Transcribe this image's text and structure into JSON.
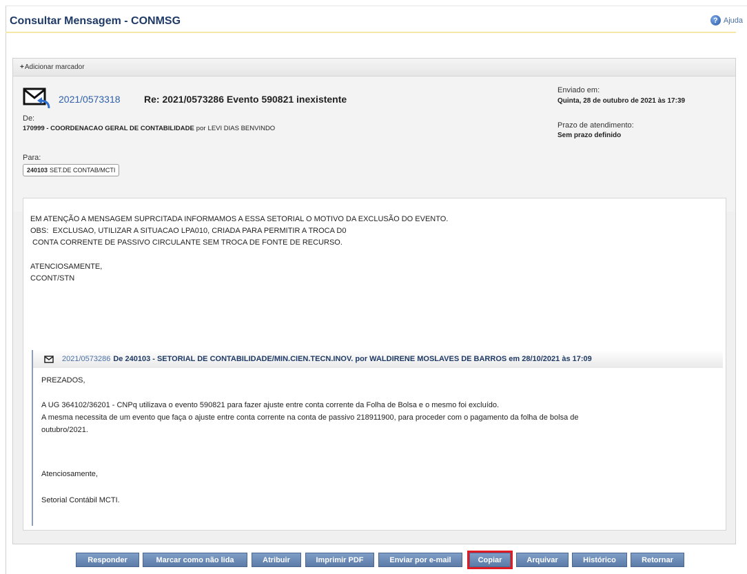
{
  "header": {
    "title": "Consultar Mensagem - CONMSG",
    "help_label": "Ajuda",
    "help_glyph": "?"
  },
  "marker": {
    "plus": "+",
    "label": "Adicionar marcador"
  },
  "message": {
    "id": "2021/0573318",
    "subject": "Re: 2021/0573286 Evento 590821 inexistente",
    "from_label": "De:",
    "from_org": "170999 - COORDENACAO GERAL DE CONTABILIDADE",
    "from_por": "por",
    "from_user": "LEVI DIAS BENVINDO",
    "sent_label": "Enviado em:",
    "sent_date": "Quinta, 28 de outubro de 2021 às 17:39",
    "deadline_label": "Prazo de atendimento:",
    "deadline_value": "Sem prazo definido",
    "to_label": "Para:",
    "to_code": "240103",
    "to_name": "SET.DE CONTAB/MCTI",
    "body": [
      "EM ATENÇÃO A MENSAGEM SUPRCITADA INFORMAMOS A ESSA SETORIAL O MOTIVO DA EXCLUSÃO DO EVENTO.",
      "OBS:  EXCLUSAO, UTILIZAR A SITUACAO LPA010, CRIADA PARA PERMITIR A TROCA D0",
      " CONTA CORRENTE DE PASSIVO CIRCULANTE SEM TROCA DE FONTE DE RECURSO.",
      "ATENCIOSAMENTE,",
      "CCONT/STN"
    ]
  },
  "quoted": {
    "id": "2021/0573286",
    "title": "De 240103 - SETORIAL DE CONTABILIDADE/MIN.CIEN.TECN.INOV. por WALDIRENE MOSLAVES DE BARROS em 28/10/2021 às 17:09",
    "body": [
      "PREZADOS,",
      "A UG 364102/36201 - CNPq utilizava o evento 590821 para fazer ajuste entre conta corrente da Folha de Bolsa e o mesmo foi excluído.",
      "A mesma necessita de um evento que faça o ajuste entre conta corrente na conta de passivo 218911900, para proceder com o pagamento da folha de bolsa de",
      "outubro/2021.",
      "Atenciosamente,",
      "Setorial Contábil MCTI."
    ]
  },
  "buttons": [
    {
      "label": "Responder"
    },
    {
      "label": "Marcar como não lida"
    },
    {
      "label": "Atribuir"
    },
    {
      "label": "Imprimir PDF"
    },
    {
      "label": "Enviar por e-mail"
    },
    {
      "label": "Copiar"
    },
    {
      "label": "Arquivar"
    },
    {
      "label": "Histórico"
    },
    {
      "label": "Retornar"
    }
  ],
  "colors": {
    "button": "#6d8cb8",
    "highlight": "#e01b24",
    "title": "#1f3a66",
    "link": "#2f5fa8"
  }
}
